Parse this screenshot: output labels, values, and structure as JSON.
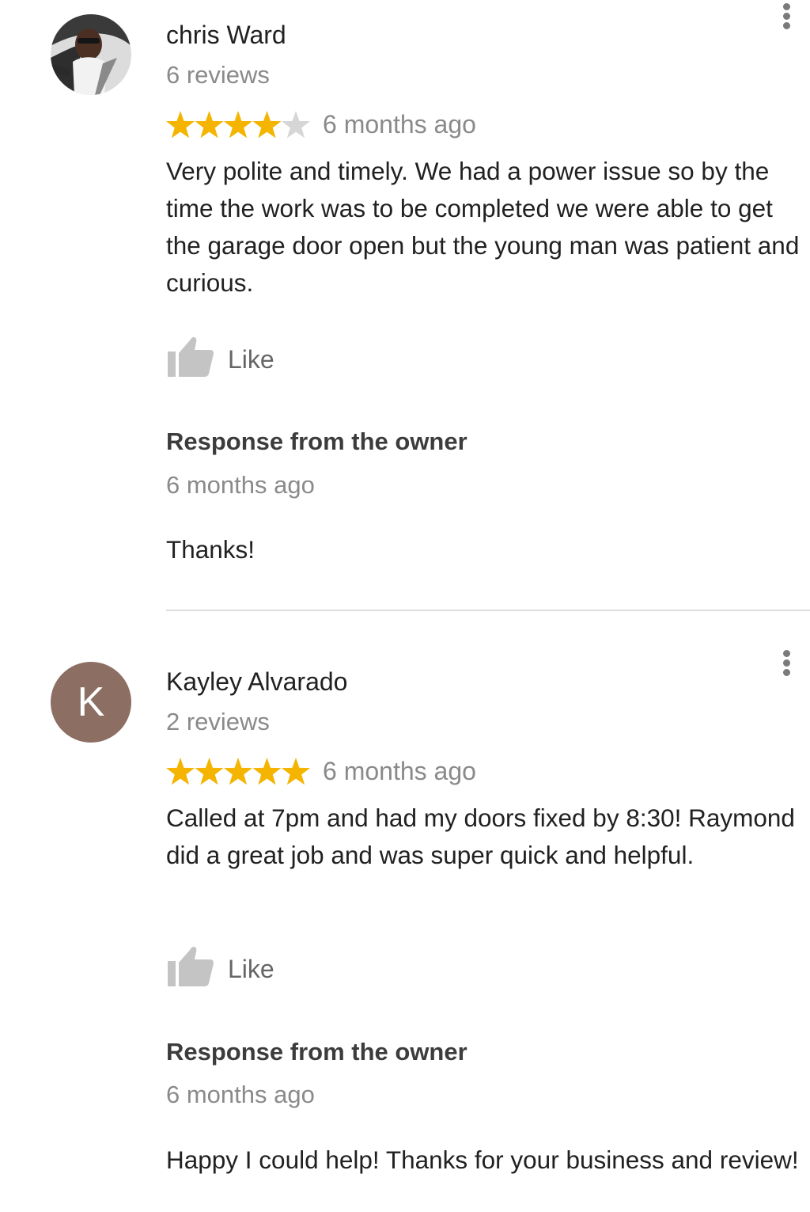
{
  "reviews": [
    {
      "reviewer_name": "chris Ward",
      "review_count": "6 reviews",
      "avatar_type": "photo",
      "rating": 4,
      "max_rating": 5,
      "date": "6 months ago",
      "text": "Very polite and timely. We had a power issue so by the time the work was to be completed we were able to get the garage door open but the young man was patient and curious.",
      "like_label": "Like",
      "owner_response": {
        "title": "Response from the owner",
        "date": "6 months ago",
        "text": "Thanks!"
      }
    },
    {
      "reviewer_name": "Kayley Alvarado",
      "review_count": "2 reviews",
      "avatar_type": "letter",
      "avatar_letter": "K",
      "avatar_color": "#8d6e63",
      "rating": 5,
      "max_rating": 5,
      "date": "6 months ago",
      "text": "Called at 7pm and had my doors fixed by 8:30! Raymond did a great job and was super quick and helpful.",
      "like_label": "Like",
      "owner_response": {
        "title": "Response from the owner",
        "date": "6 months ago",
        "text": "Happy I could help! Thanks for your business and review!"
      }
    }
  ],
  "icons": {
    "star_filled": "star-icon",
    "star_empty": "star-outline-icon",
    "like": "thumbs-up-icon",
    "menu": "more-vertical-icon"
  },
  "colors": {
    "star_filled": "#f4b400",
    "star_empty": "#d6d6d6",
    "like_icon": "#c4c4c4",
    "menu_dots": "#7a7a7a",
    "secondary_text": "#8a8a8a"
  }
}
